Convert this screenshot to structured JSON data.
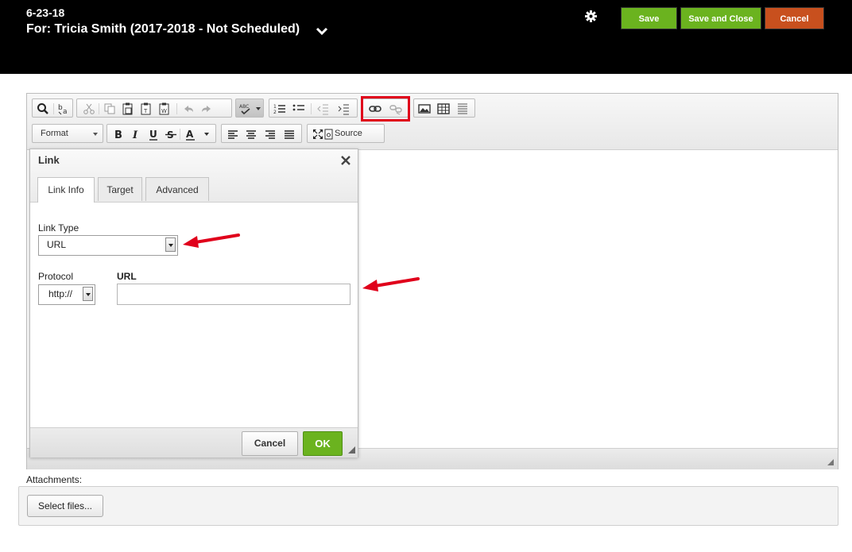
{
  "header": {
    "title": "6-23-18",
    "subtitle": "For: Tricia Smith (2017-2018 - Not Scheduled)",
    "save_label": "Save",
    "save_close_label": "Save and Close",
    "cancel_label": "Cancel"
  },
  "toolbar": {
    "format_label": "Format",
    "source_label": "Source",
    "icons": [
      "find-icon",
      "replace-icon",
      "cut-icon",
      "copy-icon",
      "paste-icon",
      "paste-text-icon",
      "paste-word-icon",
      "undo-icon",
      "redo-icon",
      "spellcheck-icon",
      "numbered-list-icon",
      "bulleted-list-icon",
      "outdent-icon",
      "indent-icon",
      "link-icon",
      "unlink-icon",
      "image-icon",
      "table-icon",
      "horizontal-rule-icon",
      "bold-icon",
      "italic-icon",
      "underline-icon",
      "strikethrough-icon",
      "text-color-icon",
      "align-left-icon",
      "align-center-icon",
      "align-right-icon",
      "justify-icon",
      "maximize-icon",
      "source-icon"
    ]
  },
  "dialog": {
    "title": "Link",
    "tabs": [
      "Link Info",
      "Target",
      "Advanced"
    ],
    "link_type_label": "Link Type",
    "link_type_value": "URL",
    "protocol_label": "Protocol",
    "protocol_value": "http://",
    "url_label": "URL",
    "url_value": "",
    "cancel_label": "Cancel",
    "ok_label": "OK"
  },
  "attachments": {
    "label": "Attachments:",
    "select_files_label": "Select files..."
  },
  "colors": {
    "header_bg": "#000000",
    "accent_green": "#6bb31f",
    "cancel_orange": "#c8501e",
    "annotation_red": "#e0001b"
  }
}
